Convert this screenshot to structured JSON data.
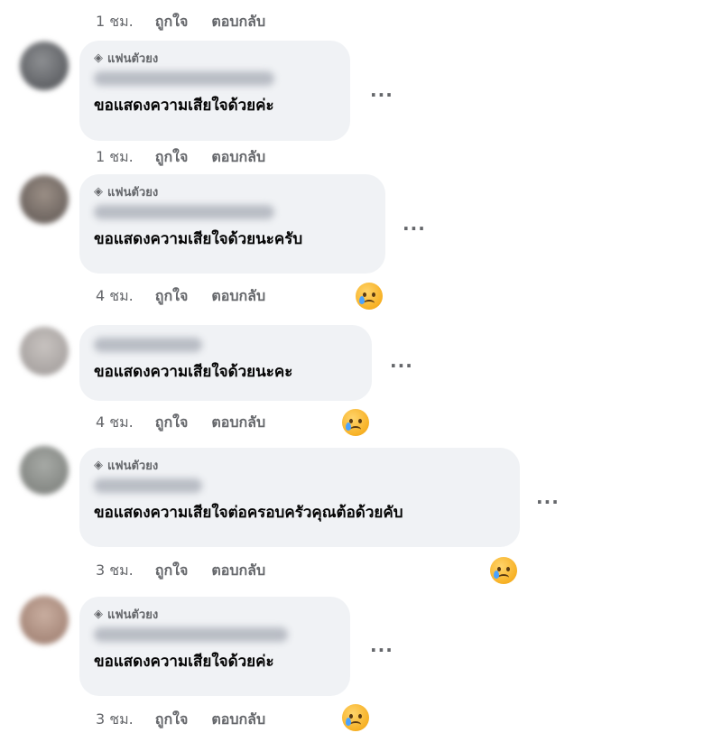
{
  "actions": {
    "like": "ถูกใจ",
    "reply": "ตอบกลับ"
  },
  "badge_label": "แฟนตัวยง",
  "more_label": "...",
  "comments": [
    {
      "time": "1 ชม.",
      "has_badge": false
    },
    {
      "time": "1 ชม.",
      "has_badge": true,
      "text": "ขอแสดงความเสียใจด้วยค่ะ"
    },
    {
      "time": "4 ชม.",
      "has_badge": true,
      "text": "ขอแสดงความเสียใจด้วยนะครับ"
    },
    {
      "time": "4 ชม.",
      "has_badge": false,
      "text": "ขอแสดงความเสียใจด้วยนะคะ"
    },
    {
      "time": "3 ชม.",
      "has_badge": true,
      "text": "ขอแสดงความเสียใจต่อครอบครัวคุณต้อด้วยคับ"
    },
    {
      "time": "3 ชม.",
      "has_badge": true,
      "text": "ขอแสดงความเสียใจด้วยค่ะ"
    }
  ],
  "colors": {
    "bubble": "#f0f2f5",
    "secondary_text": "#65676b",
    "reaction": "#f7b125"
  },
  "icons": {
    "badge": "gem-icon",
    "reaction": "sad-reaction-icon",
    "more": "more-dots-icon"
  }
}
